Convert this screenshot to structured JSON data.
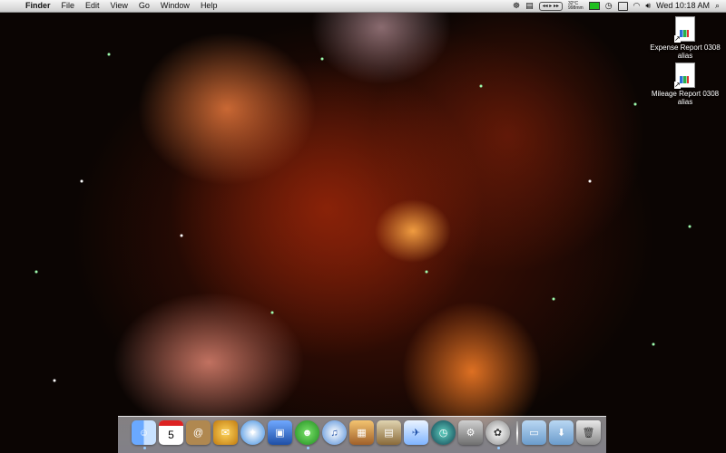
{
  "menubar": {
    "apple": "",
    "app_name": "Finder",
    "menus": [
      "File",
      "Edit",
      "View",
      "Go",
      "Window",
      "Help"
    ],
    "weather": {
      "temp": "32°C",
      "pressure": "998mm"
    },
    "clock": "Wed 10:18 AM"
  },
  "desktop_icons": [
    {
      "label": "Expense Report 0308 alias"
    },
    {
      "label": "Mileage Report 0308 alias"
    }
  ],
  "dock": {
    "calendar_day": "5",
    "items": [
      "finder-icon",
      "ical-icon",
      "address-book-icon",
      "mail-icon",
      "safari-icon",
      "preview-icon",
      "adium-icon",
      "itunes-icon",
      "iphoto-icon",
      "iphoto-library-icon",
      "mail-stamp-icon",
      "time-machine-icon",
      "system-preferences-icon",
      "stacks-icon",
      "folder-icon",
      "downloads-icon",
      "trash-icon"
    ]
  },
  "colors": {
    "menubar": "#e6e6e6",
    "battery": "#1fbf1f",
    "nebula": "#c0501c"
  }
}
